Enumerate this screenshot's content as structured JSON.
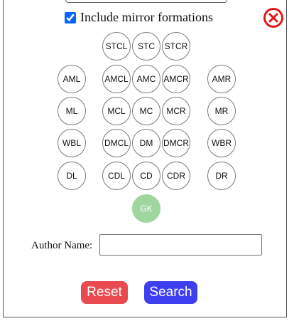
{
  "filters": {
    "mirror_label": "Include mirror formations",
    "mirror_checked": true
  },
  "close": {
    "icon": "close-x-circle-icon",
    "color": "#e31818"
  },
  "positions": {
    "STCL": "STCL",
    "STC": "STC",
    "STCR": "STCR",
    "AML": "AML",
    "AMCL": "AMCL",
    "AMC": "AMC",
    "AMCR": "AMCR",
    "AMR": "AMR",
    "ML": "ML",
    "MCL": "MCL",
    "MC": "MC",
    "MCR": "MCR",
    "MR": "MR",
    "WBL": "WBL",
    "DMCL": "DMCL",
    "DM": "DM",
    "DMCR": "DMCR",
    "WBR": "WBR",
    "DL": "DL",
    "CDL": "CDL",
    "CD": "CD",
    "CDR": "CDR",
    "DR": "DR",
    "GK": "GK"
  },
  "author": {
    "label": "Author Name:",
    "value": "",
    "placeholder": ""
  },
  "actions": {
    "reset_label": "Reset",
    "search_label": "Search"
  },
  "colors": {
    "reset": "#e84a4f",
    "search": "#3d3ef0",
    "gk_selected": "#9fd59f",
    "close": "#e31818"
  }
}
